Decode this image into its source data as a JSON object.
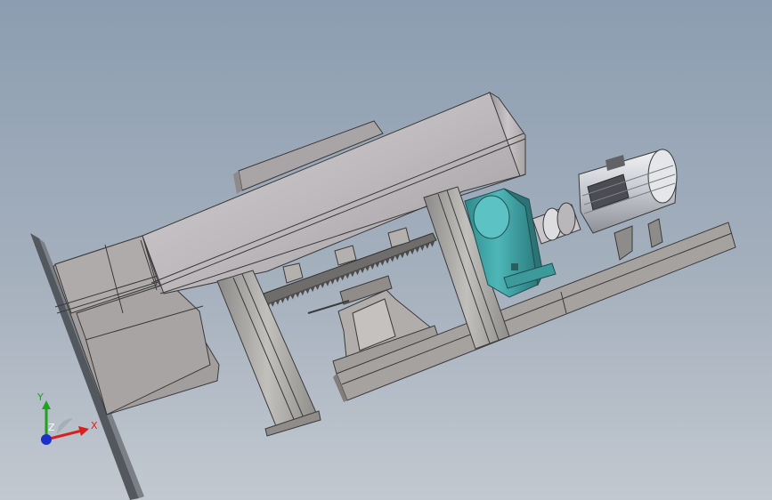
{
  "viewport": {
    "background_top": "#8c9db1",
    "background_bottom": "#c1c8d0"
  },
  "model": {
    "parts": [
      "fan-housing",
      "drive-wheel",
      "support-frame",
      "rack-gear",
      "gearbox",
      "coupling",
      "electric-motor",
      "base-rail",
      "pedestal"
    ],
    "colors": {
      "steel": "#b8b6b4",
      "steel_dark": "#7d7b79",
      "gearbox": "#3a9e9f",
      "motor": "#d9dbe0"
    }
  },
  "triad": {
    "x_label": "X",
    "y_label": "Y",
    "z_label": "Z",
    "x_color": "#d8211f",
    "y_color": "#1fa31f",
    "z_color": "#1c30c9"
  }
}
